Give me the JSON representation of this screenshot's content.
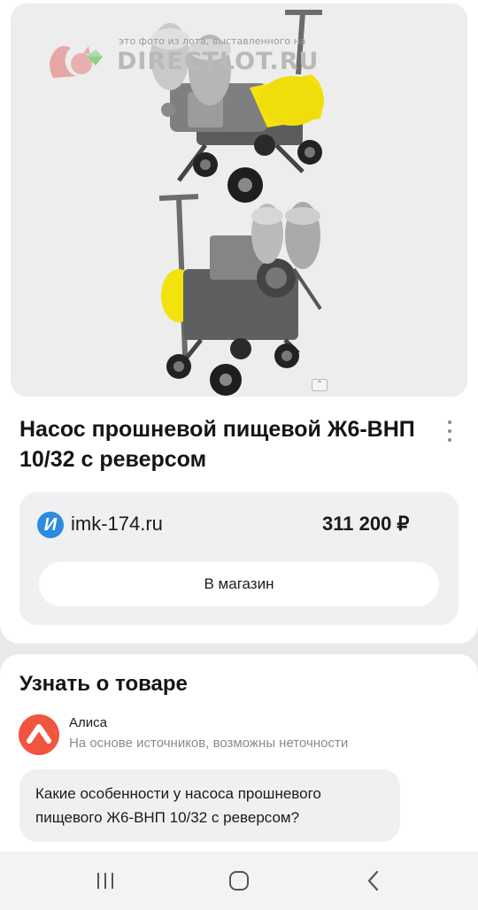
{
  "watermark": {
    "caption": "это фото из лота, выставленного на",
    "brand": "DIRECTLOT",
    "domain": ".RU"
  },
  "product": {
    "title": "Насос прошневой пищевой Ж6-ВНП 10/32 с реверсом",
    "image_icon": "pump-photo"
  },
  "offer": {
    "shop_logo_letter": "И",
    "shop_name": "imk-174.ru",
    "price": "311 200 ₽",
    "button_label": "В магазин"
  },
  "about": {
    "title": "Узнать о товаре",
    "assistant_name": "Алиса",
    "assistant_note": "На основе источников, возможны неточности",
    "question": "Какие особенности у насоса прошневого пищевого Ж6-ВНП 10/32 с реверсом?"
  },
  "navbar": {
    "recents_icon": "recents-icon",
    "home_icon": "home-icon",
    "back_icon": "back-icon"
  },
  "colors": {
    "accent_blue": "#2d8be0",
    "alice_red": "#f1543f",
    "background": "#e9e9ec",
    "card": "#ffffff",
    "pump_yellow": "#f2e20e"
  }
}
